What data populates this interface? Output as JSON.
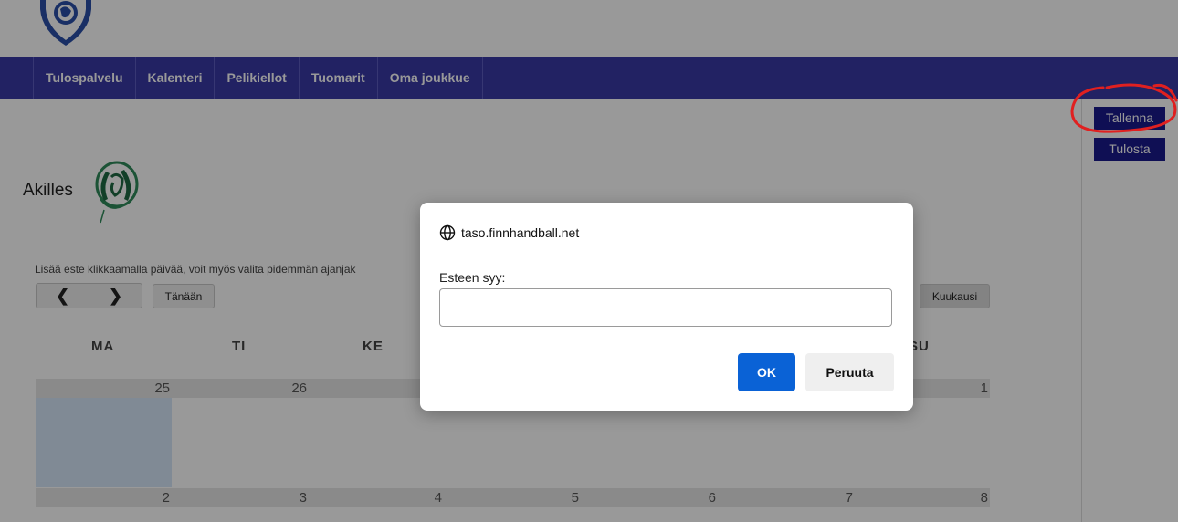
{
  "nav": {
    "items": [
      {
        "label": "Tulospalvelu"
      },
      {
        "label": "Kalenteri"
      },
      {
        "label": "Pelikiellot"
      },
      {
        "label": "Tuomarit"
      },
      {
        "label": "Oma joukkue"
      }
    ]
  },
  "sidebar": {
    "save_label": "Tallenna",
    "print_label": "Tulosta"
  },
  "team": {
    "name": "Akilles"
  },
  "calendar": {
    "hint": "Lisää este klikkaamalla päivää, voit myös valita pidemmän ajanjak",
    "today_label": "Tänään",
    "month_label": "Kuukausi",
    "day_names": [
      "MA",
      "TI",
      "KE",
      "SU"
    ],
    "week1": [
      "25",
      "26",
      "1"
    ],
    "week2": [
      "2",
      "3",
      "4",
      "5",
      "6",
      "7",
      "8"
    ]
  },
  "dialog": {
    "origin": "taso.finnhandball.net",
    "label": "Esteen syy:",
    "input_value": "",
    "ok_label": "OK",
    "cancel_label": "Peruuta"
  },
  "colors": {
    "nav_bg": "#3a3aa6",
    "side_button_bg": "#1a1a8c",
    "ok_button_bg": "#0a62d6",
    "highlight_bg": "#d6e6f8",
    "annotation_red": "#e02020"
  }
}
